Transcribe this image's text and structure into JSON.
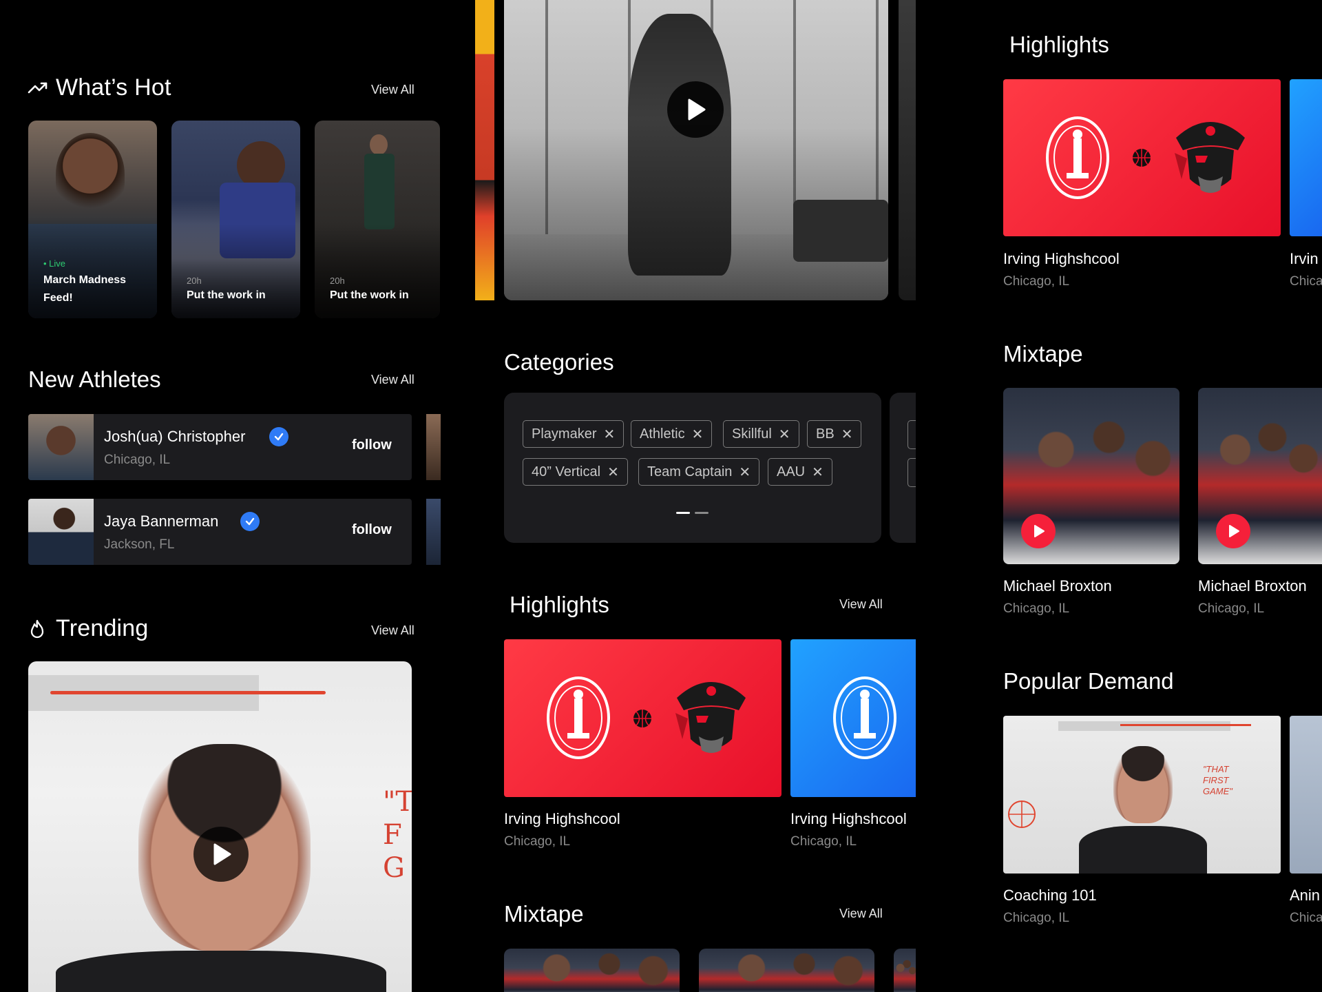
{
  "left": {
    "whats_hot": {
      "title": "What’s Hot",
      "view_all": "View All",
      "cards": [
        {
          "live": "• Live",
          "caption": "March Madness Feed!"
        },
        {
          "time": "20h",
          "caption": "Put the work in"
        },
        {
          "time": "20h",
          "caption": "Put the work in"
        }
      ]
    },
    "new_athletes": {
      "title": "New Athletes",
      "view_all": "View All",
      "items": [
        {
          "name": "Josh(ua) Christopher",
          "location": "Chicago, IL",
          "action": "follow"
        },
        {
          "name": "Jaya Bannerman",
          "location": "Jackson, FL",
          "action": "follow"
        }
      ]
    },
    "trending": {
      "title": "Trending",
      "view_all": "View All",
      "overlay_text": "\"T F G"
    }
  },
  "middle": {
    "categories": {
      "title": "Categories",
      "chips": [
        "Playmaker",
        "Athletic",
        "Skillful",
        "BB",
        "40” Vertical",
        "Team Captain",
        "AAU"
      ]
    },
    "highlights": {
      "title": "Highlights",
      "view_all": "View All",
      "items": [
        {
          "name": "Irving Highshcool",
          "location": "Chicago, IL"
        },
        {
          "name": "Irving Highshcool",
          "location": "Chicago, IL"
        }
      ]
    },
    "mixtape": {
      "title": "Mixtape",
      "view_all": "View All"
    }
  },
  "right": {
    "highlights": {
      "title": "Highlights",
      "items": [
        {
          "name": "Irving Highshcool",
          "location": "Chicago, IL"
        },
        {
          "name": "Irvin",
          "location": "Chica"
        }
      ]
    },
    "mixtape": {
      "title": "Mixtape",
      "items": [
        {
          "name": "Michael Broxton",
          "location": "Chicago, IL"
        },
        {
          "name": "Michael Broxton",
          "location": "Chicago, IL"
        }
      ]
    },
    "popular_demand": {
      "title": "Popular Demand",
      "items": [
        {
          "name": "Coaching 101",
          "location": "Chicago, IL"
        },
        {
          "name": "Anin",
          "location": "Chica"
        }
      ],
      "overlay_text": "\"THAT FIRST GAME\""
    }
  },
  "colors": {
    "background": "#000000",
    "card_dark": "#1c1c1f",
    "accent_red": "#f5203a",
    "accent_blue": "#1e7cf2",
    "live_green": "#2ecc71",
    "verify_blue": "#2f7bf6"
  }
}
